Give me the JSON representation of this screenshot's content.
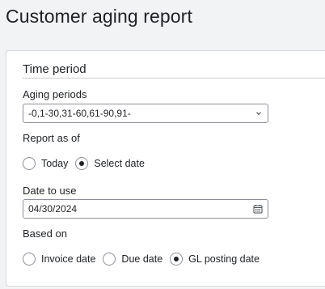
{
  "page": {
    "title": "Customer aging report"
  },
  "time_period": {
    "section_title": "Time period",
    "aging_periods": {
      "label": "Aging periods",
      "value": "-0,1-30,31-60,61-90,91-",
      "icon": "chevron-down-icon"
    },
    "report_as_of": {
      "label": "Report as of",
      "options": [
        {
          "label": "Today",
          "checked": false
        },
        {
          "label": "Select date",
          "checked": true
        }
      ]
    },
    "date_to_use": {
      "label": "Date to use",
      "value": "04/30/2024",
      "icon": "calendar-icon"
    },
    "based_on": {
      "label": "Based on",
      "options": [
        {
          "label": "Invoice date",
          "checked": false
        },
        {
          "label": "Due date",
          "checked": false
        },
        {
          "label": "GL posting date",
          "checked": true
        }
      ]
    }
  }
}
